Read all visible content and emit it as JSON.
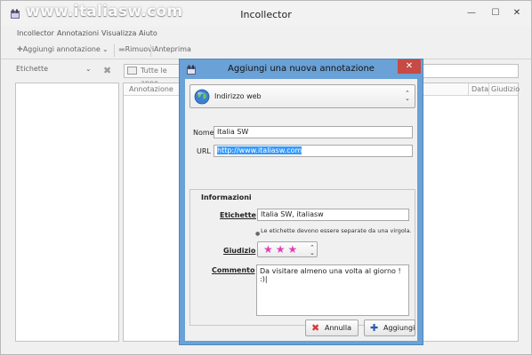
{
  "watermark": "www.italiasw.com",
  "window": {
    "title": "Incollector",
    "controls": {
      "minimize": "—",
      "maximize": "☐",
      "close": "✕"
    }
  },
  "menu": [
    {
      "label": "Incollector"
    },
    {
      "label": "Annotazioni"
    },
    {
      "label": "Visualizza"
    },
    {
      "label": "Aiuto"
    }
  ],
  "toolbar": {
    "add_label": "Aggiungi annotazione",
    "add_dropdown": "⌄",
    "remove_label": "Rimuovi",
    "preview_label": "Anteprima"
  },
  "filter": {
    "tags_label": "Etichette",
    "tags_arrow": "⌄",
    "clear_icon": "✖",
    "all_label": "Tutte le anno"
  },
  "list": {
    "columns": [
      "Annotazione",
      "Data",
      "Giudizio"
    ]
  },
  "dialog": {
    "title": "Aggiungi una nuova annotazione",
    "close": "✕",
    "type_selected": "Indirizzo web",
    "type_arrows": "⌃⌄",
    "name_label": "Nome",
    "name_value": "Italia SW",
    "url_label": "URL",
    "url_value": "http://www.italiasw.com",
    "group_title": "Informazioni",
    "tags_label": "Etichette",
    "tags_value": "Italia SW, italiasw",
    "tags_hint": "Le etichette devono essere separate da una virgola.",
    "rating_label": "Giudizio",
    "rating_value": 3,
    "rating_max": 3,
    "rating_stars": "★★★",
    "comment_label": "Commento",
    "comment_value": "Da visitare almeno una volta al giorno ! :)|",
    "cancel_label": "Annulla",
    "cancel_icon": "✖",
    "add_label": "Aggiungi",
    "add_icon": "✚"
  },
  "colors": {
    "dialog_frame": "#6aa1d6",
    "close_red": "#c74a44",
    "star_pink": "#e23fb9",
    "selection_blue": "#3399ff"
  }
}
